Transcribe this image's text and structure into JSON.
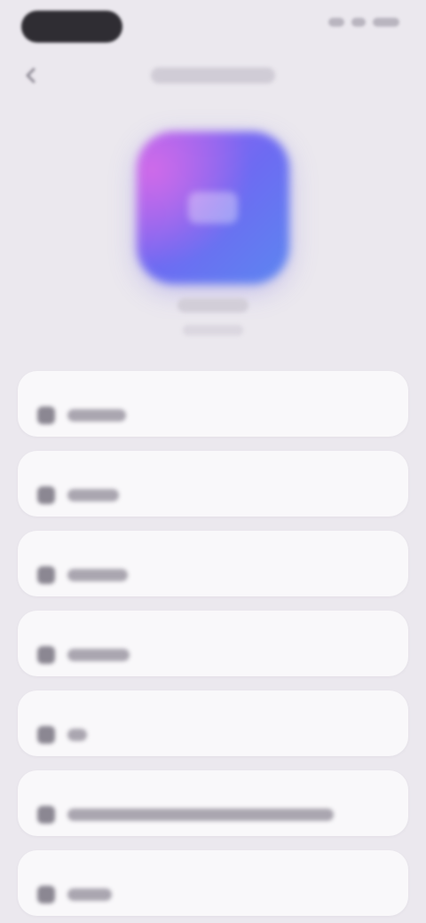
{
  "status_bar": {
    "time": "",
    "icons": [
      "signal-icon",
      "wifi-icon",
      "battery-icon"
    ]
  },
  "nav": {
    "back_icon": "chevron-left-icon",
    "title": ""
  },
  "hero": {
    "app_name": "",
    "subtitle": "",
    "icon_colors": [
      "#cf6be9",
      "#9b5ff0",
      "#6d6bf2",
      "#5c86f0"
    ]
  },
  "settings_rows": [
    {
      "label": ""
    },
    {
      "label": ""
    },
    {
      "label": ""
    },
    {
      "label": ""
    },
    {
      "label": ""
    },
    {
      "label": ""
    },
    {
      "label": ""
    }
  ]
}
